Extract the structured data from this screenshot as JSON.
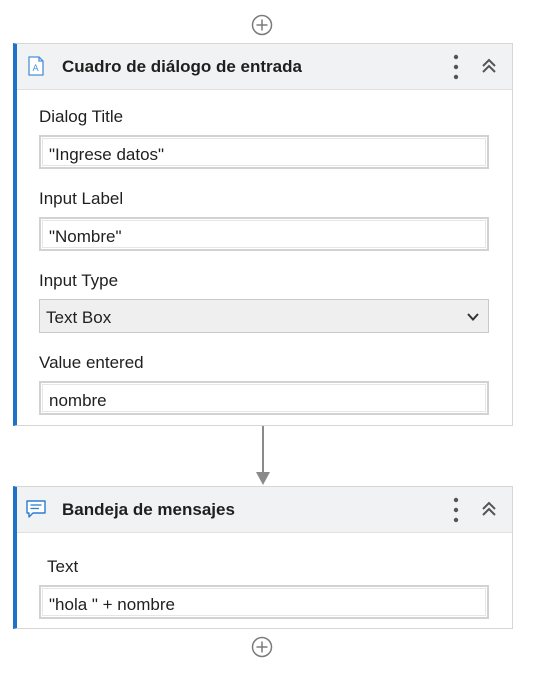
{
  "activities": [
    {
      "title": "Cuadro de diálogo de entrada",
      "fields": {
        "dialog_title": {
          "label": "Dialog Title",
          "value": "\"Ingrese datos\""
        },
        "input_label": {
          "label": "Input Label",
          "value": "\"Nombre\""
        },
        "input_type": {
          "label": "Input Type",
          "value": "Text Box"
        },
        "value_entered": {
          "label": "Value entered",
          "value": "nombre"
        }
      }
    },
    {
      "title": "Bandeja de mensajes",
      "fields": {
        "text": {
          "label": "Text",
          "value": "\"hola \" + nombre"
        }
      }
    }
  ],
  "colors": {
    "accent": "#1e73c9",
    "icon_gray": "#6b6b6b"
  },
  "icons": [
    "plus-circle-icon",
    "input-dialog-icon",
    "message-box-icon",
    "kebab-menu-icon",
    "collapse-chevrons-icon",
    "chevron-down-icon"
  ]
}
